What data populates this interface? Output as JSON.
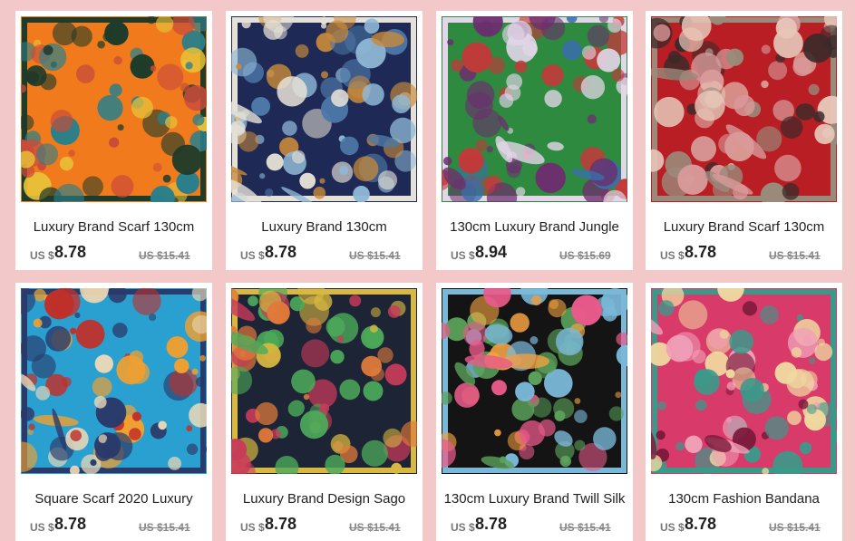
{
  "products": [
    {
      "title": "Luxury Brand Scarf 130cm",
      "currency": "US $",
      "price": "8.78",
      "old_price": "US $15.41",
      "palette": [
        "#f07a1c",
        "#2a7f8a",
        "#e8c43a",
        "#1f3b2a",
        "#c94b3a"
      ],
      "icon": "scarf-image-tropical-orange"
    },
    {
      "title": "Luxury Brand 130cm",
      "currency": "US $",
      "price": "8.78",
      "old_price": "US $15.41",
      "palette": [
        "#1e2a55",
        "#4d78a8",
        "#8fb8d6",
        "#e6e1d6",
        "#c98a3a"
      ],
      "icon": "scarf-image-navy-floral-frame"
    },
    {
      "title": "130cm Luxury Brand Jungle",
      "currency": "US $",
      "price": "8.94",
      "old_price": "US $15.69",
      "palette": [
        "#2e8a3e",
        "#c23a3a",
        "#6b2f6e",
        "#e2d6e8",
        "#3a6fa8"
      ],
      "icon": "scarf-image-jungle"
    },
    {
      "title": "Luxury Brand Scarf 130cm",
      "currency": "US $",
      "price": "8.78",
      "old_price": "US $15.41",
      "palette": [
        "#b81e24",
        "#3a2a2a",
        "#d89a9a",
        "#9a8a7a",
        "#e6c6b8"
      ],
      "icon": "scarf-image-red-ornate"
    },
    {
      "title": "Square Scarf 2020 Luxury",
      "currency": "US $",
      "price": "8.78",
      "old_price": "US $15.41",
      "palette": [
        "#2aa0d0",
        "#f0a030",
        "#c0302a",
        "#2a3a6a",
        "#e8d8b8"
      ],
      "icon": "scarf-image-blue-tree"
    },
    {
      "title": "Luxury Brand Design Sago",
      "currency": "US $",
      "price": "8.78",
      "old_price": "US $15.41",
      "palette": [
        "#1c2436",
        "#4caa5a",
        "#e07a3a",
        "#d8b840",
        "#c83a5a"
      ],
      "icon": "scarf-image-palms-navy"
    },
    {
      "title": "130cm Luxury Brand Twill Silk",
      "currency": "US $",
      "price": "8.78",
      "old_price": "US $15.41",
      "palette": [
        "#141414",
        "#e85a8a",
        "#f0a040",
        "#7ab8d8",
        "#5aa05a"
      ],
      "icon": "scarf-image-black-floral"
    },
    {
      "title": "130cm Fashion Bandana",
      "currency": "US $",
      "price": "8.78",
      "old_price": "US $15.41",
      "palette": [
        "#d83a6a",
        "#7a1a3a",
        "#f0a0b8",
        "#3a9a8a",
        "#f0d8a0"
      ],
      "icon": "scarf-image-pink-paisley"
    }
  ]
}
